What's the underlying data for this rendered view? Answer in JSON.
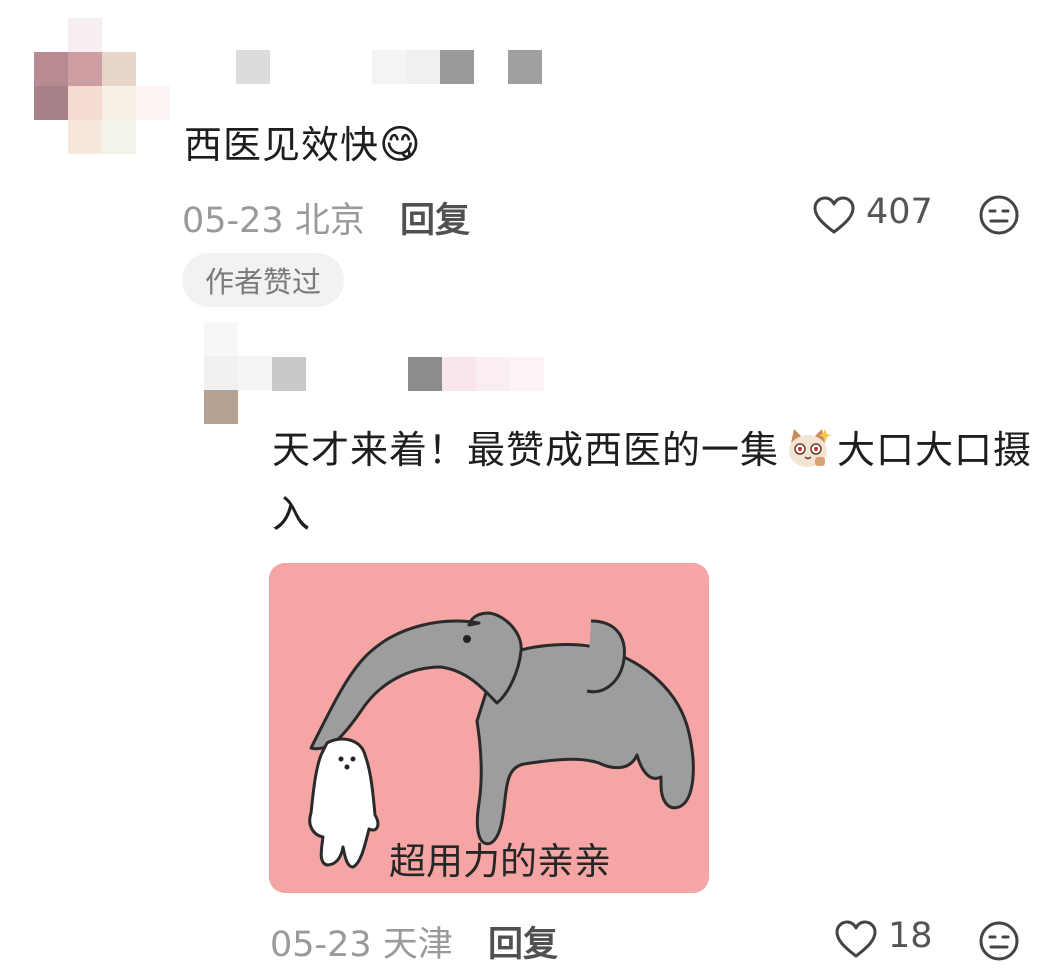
{
  "comments": [
    {
      "text": "西医见效快",
      "emoji": "😋",
      "date": "05-23",
      "location": "北京",
      "reply_label": "回复",
      "like_count": "407",
      "badge": "作者赞过"
    },
    {
      "text_part1": "天才来着！最赞成西医的一集",
      "text_part2": "大口大口摄入",
      "meme_caption": "超用力的亲亲",
      "date": "05-23",
      "location": "天津",
      "reply_label": "回复",
      "like_count": "18"
    }
  ],
  "icons": {
    "like": "heart-outline-icon",
    "dislike": "neutral-face-icon",
    "emoji_sticker": "cat-face-sticker-icon"
  },
  "colors": {
    "meta_gray": "#9a9a9a",
    "meme_background": "#f4a5a4",
    "badge_background": "#f2f2f2"
  }
}
